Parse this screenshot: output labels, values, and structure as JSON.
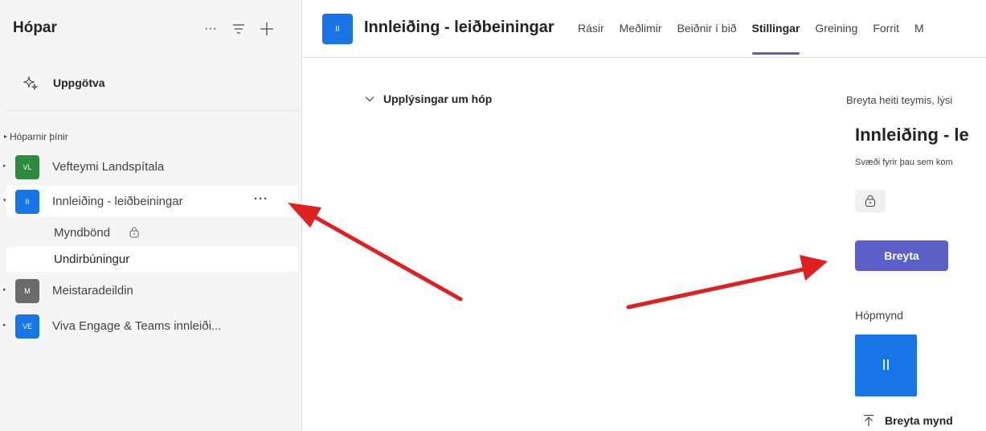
{
  "sidebar": {
    "title": "Hópar",
    "actions": [
      {
        "icon": "more-icon",
        "glyph": "···"
      },
      {
        "icon": "filter-icon",
        "glyph": "≡"
      },
      {
        "icon": "plus-icon",
        "glyph": "+"
      }
    ],
    "discover_label": "Uppgötva",
    "section_label": "Hóparnir þínir",
    "teams": [
      {
        "name": "Vefteymi Landspítala",
        "initials": "VL",
        "color": "#2e8b3e"
      },
      {
        "name": "Innleiðing - leiðbeiningar",
        "initials": "II",
        "color": "#1775e8",
        "more": "···"
      },
      {
        "name": "Meistaradeildin",
        "initials": "M",
        "color": "#6b6b6b"
      },
      {
        "name": "Viva Engage & Teams innleiði...",
        "initials": "VE",
        "color": "#1775e8"
      }
    ],
    "channels": [
      {
        "name": "Myndbönd"
      },
      {
        "name": "Undirbúningur"
      }
    ]
  },
  "header": {
    "initials": "II",
    "title": "Innleiðing - leiðbeiningar",
    "tabs": [
      "Rásir",
      "Meðlimir",
      "Beiðnir í bið",
      "Stillingar",
      "Greining",
      "Forrit",
      "M"
    ],
    "active_tab": "Stillingar"
  },
  "main": {
    "accordion_label": "Upplýsingar um hóp",
    "right": {
      "description": "Breyta heiti teymis, lýsi",
      "team_title": "Innleiðing - le",
      "team_sub": "Svæði fyrir þau sem kom",
      "edit_button": "Breyta",
      "picture_section": "Hópmynd",
      "picture_initials": "II",
      "change_picture": "Breyta mynd"
    }
  },
  "colors": {
    "accent": "#5b5fc7",
    "team_blue": "#1775e8",
    "arrow_red": "#e02020"
  }
}
